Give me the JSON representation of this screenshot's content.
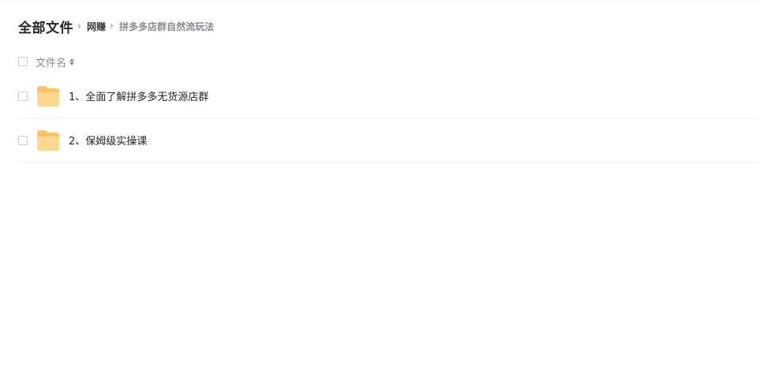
{
  "breadcrumb": {
    "root": "全部文件",
    "mid": "网赚",
    "current": "拼多多店群自然流玩法"
  },
  "list_header": {
    "name_label": "文件名"
  },
  "files": [
    {
      "name": "1、全面了解拼多多无货源店群",
      "icon": "folder-icon"
    },
    {
      "name": "2、保姆级实操课",
      "icon": "folder-icon"
    }
  ],
  "colors": {
    "folder": "#fcc567",
    "folder_front": "#ffd98f",
    "text_primary": "#25262b",
    "text_secondary": "#878a92",
    "divider": "#f0f0f2"
  }
}
